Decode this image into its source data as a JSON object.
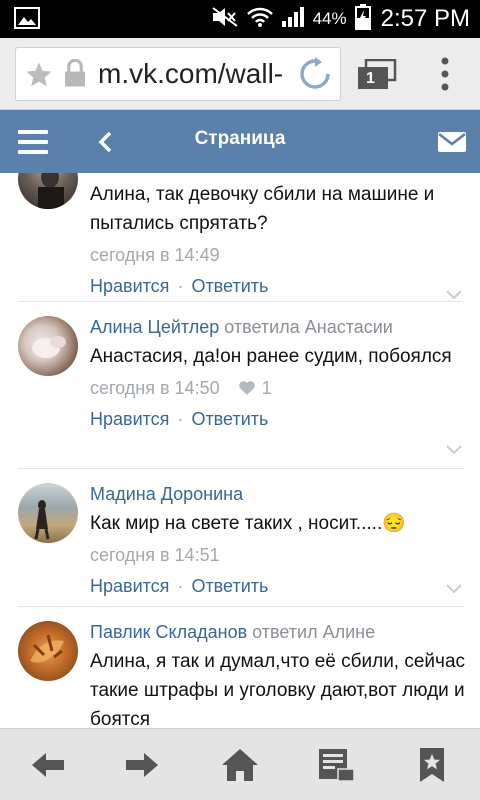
{
  "status_bar": {
    "battery_percent": "44%",
    "time": "2:57 PM"
  },
  "browser": {
    "url": "m.vk.com/wall-",
    "tab_count": "1"
  },
  "header": {
    "title": "Страница"
  },
  "comments": [
    {
      "author": "",
      "replied_to": "",
      "text": "Алина, так девочку сбили на машине и пытались спрятать?",
      "time": "сегодня в 14:49",
      "likes": "",
      "like_label": "Нравится",
      "reply_label": "Ответить"
    },
    {
      "author": "Алина Цейтлер",
      "replied_to": "ответила Анастасии",
      "text": "Анастасия, да!он ранее судим, побоялся",
      "time": "сегодня в 14:50",
      "likes": "1",
      "like_label": "Нравится",
      "reply_label": "Ответить"
    },
    {
      "author": "Мадина Доронина",
      "replied_to": "",
      "text": "Как мир на свете таких , носит.....😔",
      "time": "сегодня в 14:51",
      "likes": "",
      "like_label": "Нравится",
      "reply_label": "Ответить"
    },
    {
      "author": "Павлик Складанов",
      "replied_to": "ответил Алине",
      "text": "Алина, я так и думал,что её сбили, сейчас такие штрафы и уголовку дают,вот люди и боятся",
      "time": "",
      "likes": "",
      "like_label": "",
      "reply_label": ""
    }
  ],
  "colors": {
    "header_bg": "#5b80a9",
    "link": "#3a6699",
    "meta": "#a3a8ae"
  }
}
